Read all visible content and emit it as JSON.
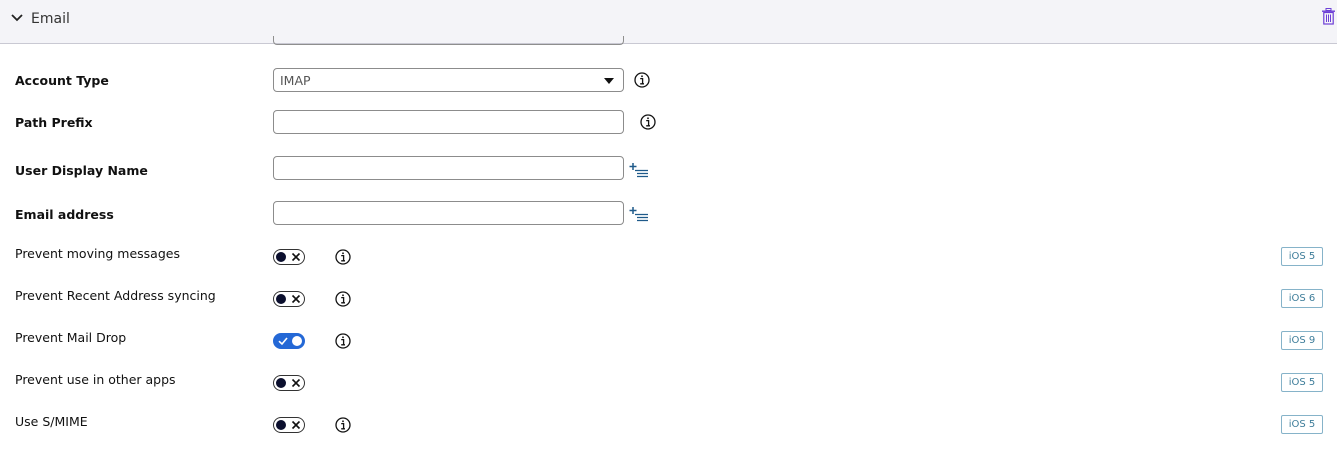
{
  "section": {
    "title": "Email",
    "chevron_icon": "chevron-down-icon",
    "delete_icon": "trash-icon"
  },
  "fields": {
    "account_type": {
      "label": "Account Type",
      "value": "IMAP",
      "info_icon": "info-icon"
    },
    "path_prefix": {
      "label": "Path Prefix",
      "value": "",
      "info_icon": "info-icon"
    },
    "user_display_name": {
      "label": "User Display Name",
      "value": "",
      "action_icon": "add-list-icon"
    },
    "email_address": {
      "label": "Email address",
      "value": "",
      "action_icon": "add-list-icon"
    }
  },
  "toggles": [
    {
      "label": "Prevent moving messages",
      "on": false,
      "info": true,
      "badge": "iOS 5"
    },
    {
      "label": "Prevent Recent Address syncing",
      "on": false,
      "info": true,
      "badge": "iOS 6"
    },
    {
      "label": "Prevent Mail Drop",
      "on": true,
      "info": true,
      "badge": "iOS 9"
    },
    {
      "label": "Prevent use in other apps",
      "on": false,
      "info": false,
      "badge": "iOS 5"
    },
    {
      "label": "Use S/MIME",
      "on": false,
      "info": true,
      "badge": "iOS 5"
    }
  ],
  "colors": {
    "toggle_on": "#2468d6",
    "toggle_knob_off": "#0b0f2e",
    "badge_border": "#86b3c9",
    "badge_text": "#3e7d9a",
    "header_bg": "#f4f4f8",
    "trash_icon": "#6d3fd6",
    "add_list_icon": "#1f5a8a"
  }
}
